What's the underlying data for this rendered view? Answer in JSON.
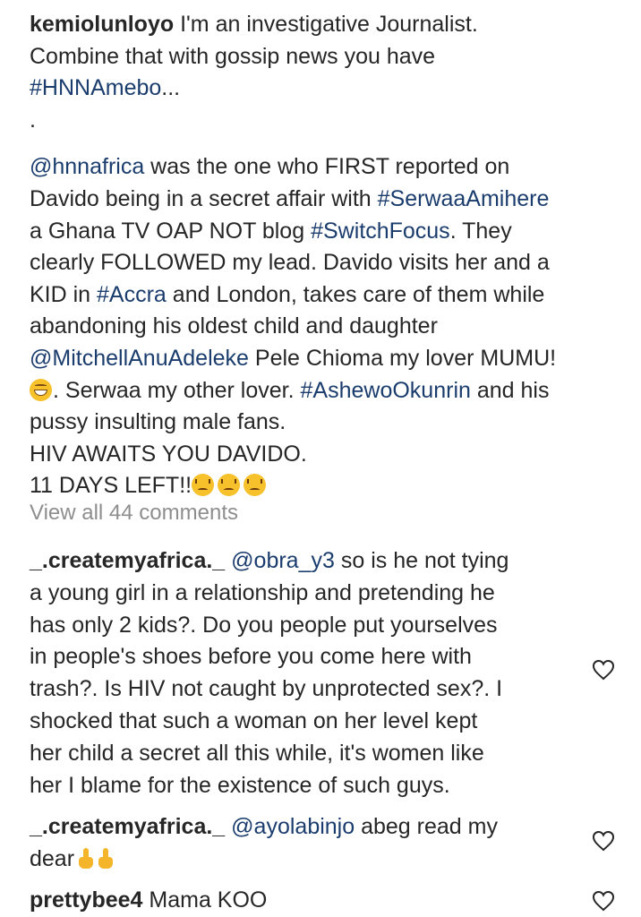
{
  "caption": {
    "username": "kemiolunloyo",
    "line1_text": " I'm an investigative Journalist.",
    "line2": "Combine that with gossip news you have",
    "line3_tag": "#HNNAmebo",
    "line3_more": "...",
    "dot": ".",
    "p_mention1": "@hnnafrica",
    "p_text1": " was the one who FIRST reported on",
    "p_text2": "Davido being in a secret affair with ",
    "p_tag1": "#SerwaaAmihere",
    "p_text3": "a Ghana TV OAP NOT blog ",
    "p_tag2": "#SwitchFocus",
    "p_text4": ". They",
    "p_text5": "clearly FOLLOWED my lead. Davido visits her and a",
    "p_text6": "KID in ",
    "p_tag3": "#Accra",
    "p_text7": " and London, takes care of them while",
    "p_text8": "abandoning his oldest child and daughter",
    "p_mention2": "@MitchellAnuAdeleke",
    "p_text9": " Pele Chioma my lover MUMU!",
    "p_text10": ". Serwaa my other lover. ",
    "p_tag4": "#AshewoOkunrin",
    "p_text11": " and his",
    "p_text12": "pussy insulting male fans.",
    "p_text13": "HIV AWAITS YOU DAVIDO.",
    "p_text14": "11 DAYS LEFT!!"
  },
  "view_all_comments": "View all 44 comments",
  "comments": [
    {
      "username": "_.createmyafrica._",
      "mention": "@obra_y3",
      "lines": [
        " so is he not tying",
        "a young girl in a relationship and pretending he",
        "has only 2 kids?. Do you people put yourselves",
        "in people's shoes before you come here with",
        "trash?. Is HIV not caught by unprotected sex?. I",
        "shocked that such a woman on her level kept",
        "her child a secret all this while, it's women like",
        "her I blame for the existence of such guys."
      ]
    },
    {
      "username": "_.createmyafrica._",
      "mention": "@ayolabinjo",
      "lines": [
        " abeg read my",
        "dear"
      ]
    },
    {
      "username": "prettybee4",
      "mention": "",
      "lines": [
        " Mama KOO"
      ]
    }
  ],
  "icons": {
    "like": "heart-outline-icon",
    "grin_emoji": "grinning-face-emoji",
    "angry_emoji": "persevering-face-emoji",
    "hand_emoji": "pointing-up-hand-emoji"
  },
  "colors": {
    "text": "#262626",
    "link": "#1b3d6e",
    "muted": "#8e8e8e"
  }
}
